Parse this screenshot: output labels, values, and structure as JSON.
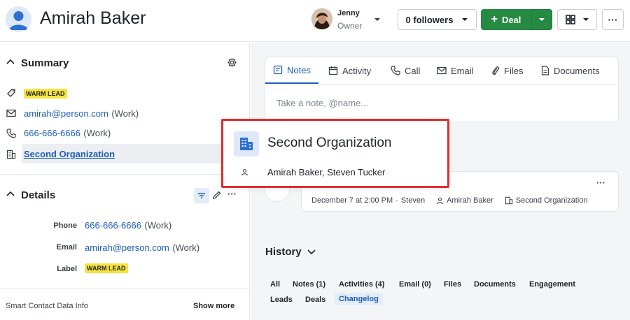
{
  "header": {
    "contact_name": "Amirah Baker",
    "owner_name": "Jenny",
    "owner_role": "Owner",
    "followers_label": "0 followers",
    "deal_label": "Deal",
    "more_label": "···"
  },
  "summary": {
    "title": "Summary",
    "label_badge": "WARM LEAD",
    "email": "amirah@person.com",
    "email_type": "(Work)",
    "phone": "666-666-6666",
    "phone_type": "(Work)",
    "organization": "Second Organization"
  },
  "details": {
    "title": "Details",
    "phone_label": "Phone",
    "phone_value": "666-666-6666",
    "phone_type": "(Work)",
    "email_label": "Email",
    "email_value": "amirah@person.com",
    "email_type": "(Work)",
    "label_label": "Label",
    "label_value": "WARM LEAD",
    "smart_data": "Smart Contact Data Info",
    "show_more": "Show more"
  },
  "composer": {
    "tabs": [
      {
        "label": "Notes",
        "icon": "note-icon"
      },
      {
        "label": "Activity",
        "icon": "calendar-icon"
      },
      {
        "label": "Call",
        "icon": "phone-icon"
      },
      {
        "label": "Email",
        "icon": "envelope-icon"
      },
      {
        "label": "Files",
        "icon": "paperclip-icon"
      },
      {
        "label": "Documents",
        "icon": "document-icon"
      }
    ],
    "placeholder": "Take a note, @name..."
  },
  "activity": {
    "date": "December 7 at 2:00 PM",
    "separator": "·",
    "owner": "Steven",
    "person": "Amirah Baker",
    "organization": "Second Organization",
    "more": "···"
  },
  "history": {
    "title": "History",
    "filters": [
      "All",
      "Notes (1)",
      "Activities (4)",
      "Email (0)",
      "Files",
      "Documents",
      "Engagement",
      "Leads",
      "Deals",
      "Changelog"
    ],
    "active_filter": "Changelog"
  },
  "popover": {
    "org_name": "Second Organization",
    "people": "Amirah Baker, Steven Tucker"
  },
  "colors": {
    "accent": "#1c5eb7",
    "deal_green": "#268a43",
    "highlight_red": "#e02d2d",
    "badge_yellow": "#f7e43b"
  }
}
